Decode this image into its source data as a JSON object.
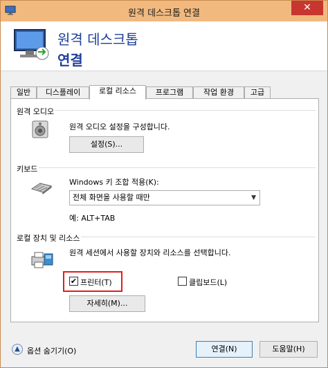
{
  "window": {
    "title": "원격 데스크톱 연결",
    "close_glyph": "✕"
  },
  "header": {
    "title_line1": "원격 데스크톱",
    "title_line2": "연결"
  },
  "tabs": [
    {
      "label": "일반"
    },
    {
      "label": "디스플레이"
    },
    {
      "label": "로컬 리소스"
    },
    {
      "label": "프로그램"
    },
    {
      "label": "작업 환경"
    },
    {
      "label": "고급"
    }
  ],
  "audio": {
    "group_title": "원격 오디오",
    "description": "원격 오디오 설정을 구성합니다.",
    "settings_button": "설정(S)..."
  },
  "keyboard": {
    "group_title": "키보드",
    "label": "Windows 키 조합 적용(K):",
    "selected": "전체 화면을 사용할 때만",
    "example": "예: ALT+TAB"
  },
  "local_devices": {
    "group_title": "로컬 장치 및 리소스",
    "description": "원격 세션에서 사용할 장치와 리소스를 선택합니다.",
    "printer_label": "프린터(T)",
    "printer_checked": true,
    "clipboard_label": "클립보드(L)",
    "clipboard_checked": false,
    "more_button": "자세히(M)..."
  },
  "footer": {
    "hide_options": "옵션 숨기기(O)",
    "connect_button": "연결(N)",
    "help_button": "도움말(H)"
  },
  "colors": {
    "title_accent": "#1f3f9a",
    "highlight": "#e21c1c"
  }
}
